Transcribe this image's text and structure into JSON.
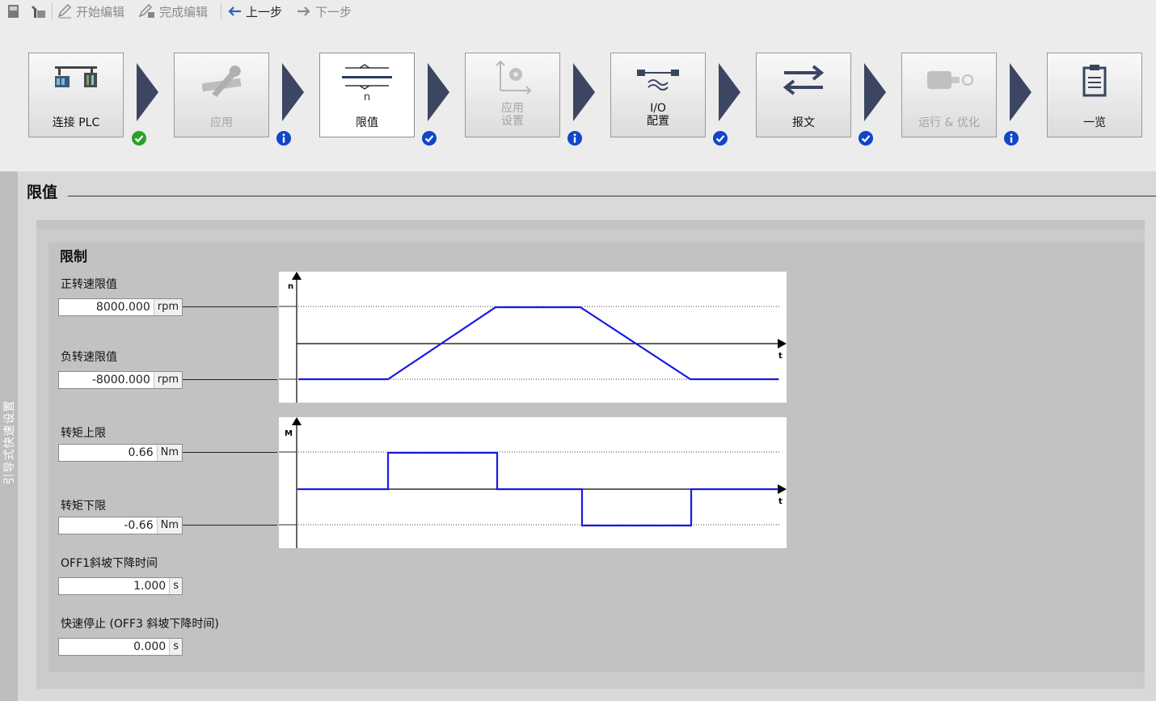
{
  "toolbar": {
    "start_edit": "开始编辑",
    "finish_edit": "完成编辑",
    "prev": "上一步",
    "next": "下一步"
  },
  "wizard": {
    "steps": [
      {
        "label": "连接 PLC",
        "state": "ok",
        "icon": "plc-connection-icon",
        "enabled": true
      },
      {
        "label": "应用",
        "state": "info",
        "icon": "wrench-ruler-icon",
        "enabled": false
      },
      {
        "label": "限值",
        "state": "check",
        "icon": "limits-icon",
        "enabled": true,
        "active": true
      },
      {
        "label": "应用\n设置",
        "state": "info",
        "icon": "application-settings-icon",
        "enabled": false
      },
      {
        "label": "I/O\n配置",
        "state": "check",
        "icon": "io-config-icon",
        "enabled": true
      },
      {
        "label": "报文",
        "state": "check",
        "icon": "telegram-arrows-icon",
        "enabled": true
      },
      {
        "label": "运行 & 优化",
        "state": "info",
        "icon": "motor-optimize-icon",
        "enabled": false
      },
      {
        "label": "一览",
        "state": "none",
        "icon": "clipboard-icon",
        "enabled": true
      }
    ],
    "line1": [
      "连接 PLC",
      "应用",
      "限值",
      "应用",
      "I/O",
      "报文",
      "运行 & 优化",
      "一览"
    ],
    "line2": [
      "",
      "",
      "",
      "设置",
      "配置",
      "",
      "",
      ""
    ]
  },
  "sidebar": {
    "label": "引导式快速设置"
  },
  "page": {
    "title": "限值"
  },
  "section": {
    "title": "限制",
    "fields": [
      {
        "label": "正转速限值",
        "value": "8000.000",
        "unit": "rpm"
      },
      {
        "label": "负转速限值",
        "value": "-8000.000",
        "unit": "rpm"
      },
      {
        "label": "转矩上限",
        "value": "0.66",
        "unit": "Nm"
      },
      {
        "label": "转矩下限",
        "value": "-0.66",
        "unit": "Nm"
      },
      {
        "label": "OFF1斜坡下降时间",
        "value": "1.000",
        "unit": "s"
      },
      {
        "label": "快速停止 (OFF3 斜坡下降时间)",
        "value": "0.000",
        "unit": "s"
      }
    ]
  },
  "charts": {
    "speed": {
      "y_label": "n",
      "x_label": "t"
    },
    "torque": {
      "y_label": "M",
      "x_label": "t"
    }
  },
  "colors": {
    "accent": "#1a1ae6",
    "arrow": "#3c4663",
    "ok": "#2aa02a",
    "info": "#1046c8"
  }
}
